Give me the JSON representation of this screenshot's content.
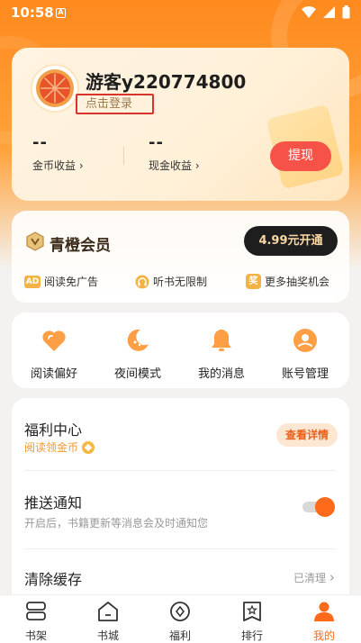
{
  "status_bar": {
    "time": "10:58",
    "notification_glyph": "A"
  },
  "user": {
    "name": "游客y220774800",
    "login_text": "点击登录",
    "coin_value": "--",
    "coin_label": "金币收益",
    "cash_value": "--",
    "cash_label": "现金收益",
    "withdraw_label": "提现"
  },
  "vip": {
    "title": "青橙会员",
    "button_label": "4.99元开通",
    "perks": [
      {
        "badge": "AD",
        "label": "阅读免广告",
        "icon": "ad-icon"
      },
      {
        "label": "听书无限制",
        "icon": "headphones-icon"
      },
      {
        "badge": "奖",
        "label": "更多抽奖机会",
        "icon": "prize-icon"
      }
    ]
  },
  "quick_actions": [
    {
      "label": "阅读偏好",
      "icon": "heart-icon"
    },
    {
      "label": "夜间模式",
      "icon": "moon-icon"
    },
    {
      "label": "我的消息",
      "icon": "bell-icon"
    },
    {
      "label": "账号管理",
      "icon": "account-icon"
    }
  ],
  "settings": {
    "welfare_title": "福利中心",
    "welfare_sub": "阅读领金币",
    "welfare_button": "查看详情",
    "push_title": "推送通知",
    "push_sub": "开启后，书籍更新等消息会及时通知您",
    "push_enabled": true,
    "cache_title": "清除缓存",
    "cache_status": "已清理"
  },
  "bottom_nav": [
    {
      "label": "书架",
      "icon": "bookshelf-icon"
    },
    {
      "label": "书城",
      "icon": "bookstore-icon"
    },
    {
      "label": "福利",
      "icon": "welfare-icon"
    },
    {
      "label": "排行",
      "icon": "ranking-icon"
    },
    {
      "label": "我的",
      "icon": "profile-icon",
      "active": true
    }
  ],
  "colors": {
    "accent": "#ff6a1a",
    "withdraw": "#f65247",
    "vip_button": "#1e1e1e"
  }
}
